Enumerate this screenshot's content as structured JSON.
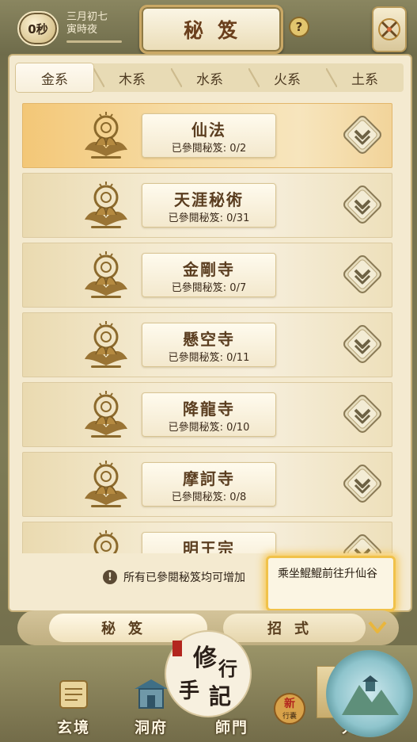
{
  "header": {
    "timer_label": "0秒",
    "date_line1": "三月初七",
    "date_line2": "寅時夜",
    "title": "秘笈",
    "help_label": "?"
  },
  "tabs": [
    {
      "label": "金系",
      "active": true
    },
    {
      "label": "木系",
      "active": false
    },
    {
      "label": "水系",
      "active": false
    },
    {
      "label": "火系",
      "active": false
    },
    {
      "label": "土系",
      "active": false
    }
  ],
  "entries": [
    {
      "name": "仙法",
      "count": "已參閱秘笈: 0/2",
      "highlighted": true
    },
    {
      "name": "天涯秘術",
      "count": "已參閱秘笈: 0/31",
      "highlighted": false
    },
    {
      "name": "金剛寺",
      "count": "已參閱秘笈: 0/7",
      "highlighted": false
    },
    {
      "name": "懸空寺",
      "count": "已參閱秘笈: 0/11",
      "highlighted": false
    },
    {
      "name": "降龍寺",
      "count": "已參閱秘笈: 0/10",
      "highlighted": false
    },
    {
      "name": "摩訶寺",
      "count": "已參閱秘笈: 0/8",
      "highlighted": false
    },
    {
      "name": "明王宗",
      "count": "",
      "highlighted": false
    }
  ],
  "notice": {
    "icon_label": "!",
    "text": "所有已參閱秘笈均可增加"
  },
  "tooltip": {
    "text": "乘坐鯤鯤前往升仙谷"
  },
  "subtabs": {
    "left": "秘笈",
    "right": "招式"
  },
  "nav": {
    "items": [
      {
        "label": "玄境"
      },
      {
        "label": "洞府"
      },
      {
        "label": "師門"
      },
      {
        "label": "人間"
      }
    ],
    "logo_text": "修行手記",
    "new_badge_label": "新",
    "new_badge_sub": "行囊"
  },
  "colors": {
    "accent_gold": "#c9a24a",
    "panel_bg": "#f4ead0",
    "highlight_row": "#f3c777",
    "tooltip_glow": "#f1c24a",
    "text_brown": "#5a3d1f"
  }
}
